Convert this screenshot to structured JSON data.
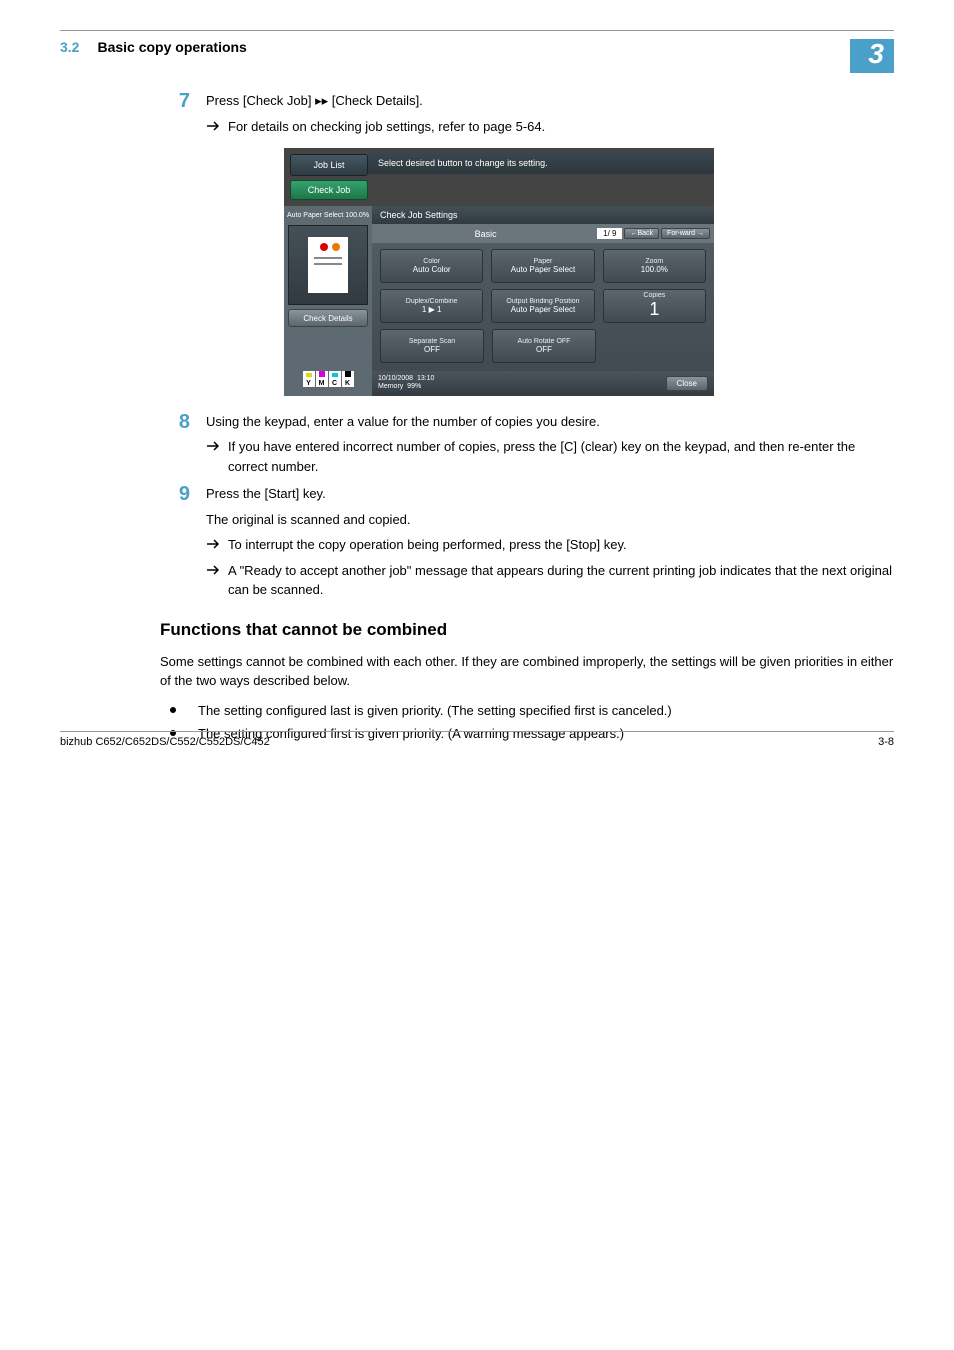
{
  "header": {
    "section_number": "3.2",
    "section_title": "Basic copy operations",
    "chapter_number": "3"
  },
  "step7": {
    "number": "7",
    "text": "Press [Check Job] ▸▸ [Check Details].",
    "sub1": "For details on checking job settings, refer to page 5-64."
  },
  "screenshot": {
    "tab_job_list": "Job List",
    "tab_check_job": "Check Job",
    "top_message": "Select desired button to change its setting.",
    "left_auto": "Auto Paper Select  100.0%",
    "check_details_btn": "Check Details",
    "title_bar": "Check Job Settings",
    "nav_basic": "Basic",
    "nav_page": "1/ 9",
    "nav_back": "←Back",
    "nav_forward": "For-ward →",
    "card_color_t": "Color",
    "card_color_v": "Auto Color",
    "card_paper_t": "Paper",
    "card_paper_v": "Auto Paper Select",
    "card_zoom_t": "Zoom",
    "card_zoom_v": "100.0%",
    "card_duplex_t": "Duplex/Combine",
    "card_duplex_v": "1 ▶ 1",
    "card_output_t": "Output Binding Position",
    "card_output_v": "Auto Paper Select",
    "card_copies_t": "Copies",
    "card_copies_v": "1",
    "card_sep_t": "Separate Scan",
    "card_sep_v": "OFF",
    "card_rot_t": "Auto Rotate OFF",
    "card_rot_v": "OFF",
    "datetime_date": "10/10/2008",
    "datetime_time": "13:10",
    "memory": "Memory",
    "memory_val": "99%",
    "close_btn": "Close",
    "toner_y": "Y",
    "toner_m": "M",
    "toner_c": "C",
    "toner_k": "K"
  },
  "step8": {
    "number": "8",
    "text": "Using the keypad, enter a value for the number of copies you desire.",
    "sub1": "If you have entered incorrect number of copies, press the [C] (clear) key on the keypad, and then re-enter the correct number."
  },
  "step9": {
    "number": "9",
    "text": "Press the [Start] key.",
    "note": "The original is scanned and copied.",
    "sub1": "To interrupt the copy operation being performed, press the [Stop] key.",
    "sub2": "A \"Ready to accept another job\" message that appears during the current printing job indicates that the next original can be scanned."
  },
  "subsection": {
    "heading": "Functions that cannot be combined",
    "para": "Some settings cannot be combined with each other. If they are combined improperly, the settings will be given priorities in either of the two ways described below.",
    "bullet1": "The setting configured last is given priority. (The setting specified first is canceled.)",
    "bullet2": "The setting configured first is given priority. (A warning message appears.)"
  },
  "footer": {
    "model": "bizhub C652/C652DS/C552/C552DS/C452",
    "page": "3-8"
  }
}
